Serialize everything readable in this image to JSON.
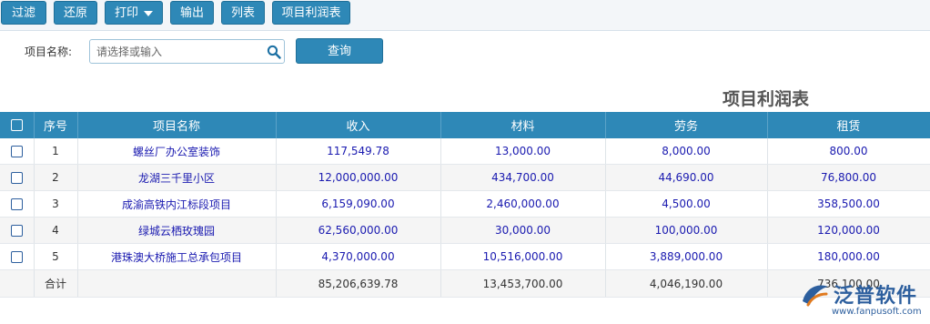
{
  "toolbar": {
    "buttons": [
      {
        "label": "过滤"
      },
      {
        "label": "还原"
      },
      {
        "label": "打印"
      },
      {
        "label": "输出"
      },
      {
        "label": "列表"
      },
      {
        "label": "项目利润表"
      }
    ]
  },
  "search": {
    "label": "项目名称:",
    "placeholder": "请选择或输入",
    "value": "",
    "query_label": "查询"
  },
  "report": {
    "title": "项目利润表"
  },
  "table": {
    "columns": [
      "序号",
      "项目名称",
      "收入",
      "材料",
      "劳务",
      "租赁"
    ],
    "rows": [
      {
        "seq": "1",
        "name": "螺丝厂办公室装饰",
        "income": "117,549.78",
        "material": "13,000.00",
        "labor": "8,000.00",
        "rental": "800.00"
      },
      {
        "seq": "2",
        "name": "龙湖三千里小区",
        "income": "12,000,000.00",
        "material": "434,700.00",
        "labor": "44,690.00",
        "rental": "76,800.00"
      },
      {
        "seq": "3",
        "name": "成渝高铁内江标段项目",
        "income": "6,159,090.00",
        "material": "2,460,000.00",
        "labor": "4,500.00",
        "rental": "358,500.00"
      },
      {
        "seq": "4",
        "name": "绿城云栖玫瑰园",
        "income": "62,560,000.00",
        "material": "30,000.00",
        "labor": "100,000.00",
        "rental": "120,000.00"
      },
      {
        "seq": "5",
        "name": "港珠澳大桥施工总承包项目",
        "income": "4,370,000.00",
        "material": "10,516,000.00",
        "labor": "3,889,000.00",
        "rental": "180,000.00"
      }
    ],
    "total": {
      "label": "合计",
      "income": "85,206,639.78",
      "material": "13,453,700.00",
      "labor": "4,046,190.00",
      "rental": "736,100.00"
    }
  },
  "watermark": {
    "brand": "泛普软件",
    "url": "www.fanpusoft.com"
  },
  "colors": {
    "accent": "#2e88b7",
    "link": "#1a1ab0"
  }
}
